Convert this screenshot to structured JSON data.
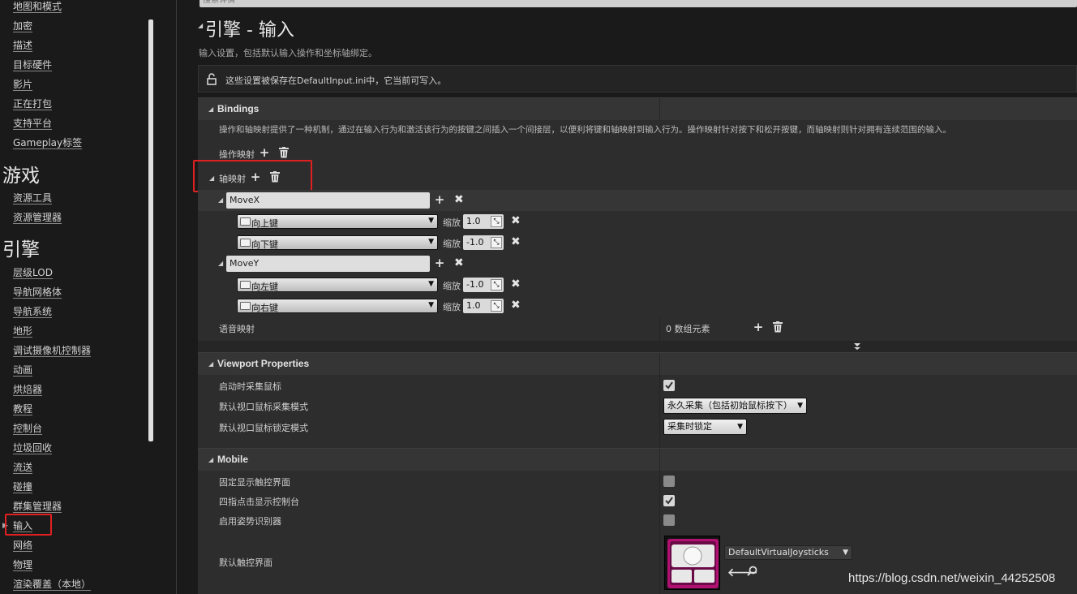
{
  "sidebar": {
    "items_top": [
      "地图和模式",
      "加密",
      "描述",
      "目标硬件",
      "影片",
      "正在打包",
      "支持平台",
      "Gameplay标签"
    ],
    "heading_game": "游戏",
    "items_game": [
      "资源工具",
      "资源管理器"
    ],
    "heading_engine": "引擎",
    "items_engine": [
      "层级LOD",
      "导航网格体",
      "导航系统",
      "地形",
      "调试摄像机控制器",
      "动画",
      "烘焙器",
      "教程",
      "控制台",
      "垃圾回收",
      "流送",
      "碰撞",
      "群集管理器",
      "输入",
      "网络",
      "物理",
      "渲染覆盖（本地）"
    ]
  },
  "search_placeholder": "搜索详情",
  "page": {
    "title": "引擎 - 输入",
    "subtitle": "输入设置，包括默认输入操作和坐标轴绑定。",
    "notice": "这些设置被保存在DefaultInput.ini中，它当前可写入。"
  },
  "bindings": {
    "heading": "Bindings",
    "description": "操作和轴映射提供了一种机制，通过在输入行为和激活该行为的按键之间插入一个间接层，以便利将键和轴映射到输入行为。操作映射针对按下和松开按键，而轴映射则针对拥有连续范围的输入。",
    "action_mappings_label": "操作映射",
    "axis_mappings_label": "轴映射",
    "scale_label": "缩放",
    "axes": [
      {
        "name": "MoveX",
        "keys": [
          {
            "key": "向上键",
            "scale": "1.0"
          },
          {
            "key": "向下键",
            "scale": "-1.0"
          }
        ]
      },
      {
        "name": "MoveY",
        "keys": [
          {
            "key": "向左键",
            "scale": "-1.0"
          },
          {
            "key": "向右键",
            "scale": "1.0"
          }
        ]
      }
    ],
    "speech_label": "语音映射",
    "speech_value": "0 数组元素"
  },
  "viewport": {
    "heading": "Viewport Properties",
    "capture_on_start_label": "启动时采集鼠标",
    "capture_on_start": true,
    "capture_mode_label": "默认视口鼠标采集模式",
    "capture_mode_value": "永久采集（包括初始鼠标按下）",
    "lock_mode_label": "默认视口鼠标锁定模式",
    "lock_mode_value": "采集时锁定"
  },
  "mobile": {
    "heading": "Mobile",
    "always_show_touch_label": "固定显示触控界面",
    "always_show_touch": false,
    "four_finger_label": "四指点击显示控制台",
    "four_finger": true,
    "gesture_label": "启用姿势识别器",
    "gesture": false,
    "default_touch_label": "默认触控界面",
    "default_touch_value": "DefaultVirtualJoysticks"
  },
  "watermark": "https://blog.csdn.net/weixin_44252508",
  "colors": {
    "highlight_box": "#e02020",
    "panel_bg": "#2d2d2d",
    "header_bg": "#353535"
  }
}
